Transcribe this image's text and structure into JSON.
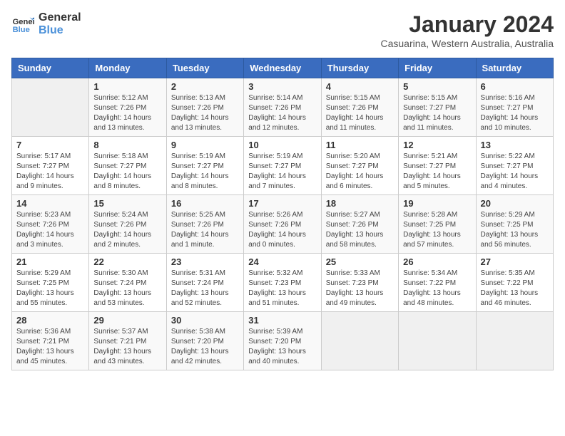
{
  "logo": {
    "name_line1": "General",
    "name_line2": "Blue"
  },
  "header": {
    "title": "January 2024",
    "subtitle": "Casuarina, Western Australia, Australia"
  },
  "days_of_week": [
    "Sunday",
    "Monday",
    "Tuesday",
    "Wednesday",
    "Thursday",
    "Friday",
    "Saturday"
  ],
  "weeks": [
    [
      {
        "day": "",
        "info": ""
      },
      {
        "day": "1",
        "info": "Sunrise: 5:12 AM\nSunset: 7:26 PM\nDaylight: 14 hours\nand 13 minutes."
      },
      {
        "day": "2",
        "info": "Sunrise: 5:13 AM\nSunset: 7:26 PM\nDaylight: 14 hours\nand 13 minutes."
      },
      {
        "day": "3",
        "info": "Sunrise: 5:14 AM\nSunset: 7:26 PM\nDaylight: 14 hours\nand 12 minutes."
      },
      {
        "day": "4",
        "info": "Sunrise: 5:15 AM\nSunset: 7:26 PM\nDaylight: 14 hours\nand 11 minutes."
      },
      {
        "day": "5",
        "info": "Sunrise: 5:15 AM\nSunset: 7:27 PM\nDaylight: 14 hours\nand 11 minutes."
      },
      {
        "day": "6",
        "info": "Sunrise: 5:16 AM\nSunset: 7:27 PM\nDaylight: 14 hours\nand 10 minutes."
      }
    ],
    [
      {
        "day": "7",
        "info": "Sunrise: 5:17 AM\nSunset: 7:27 PM\nDaylight: 14 hours\nand 9 minutes."
      },
      {
        "day": "8",
        "info": "Sunrise: 5:18 AM\nSunset: 7:27 PM\nDaylight: 14 hours\nand 8 minutes."
      },
      {
        "day": "9",
        "info": "Sunrise: 5:19 AM\nSunset: 7:27 PM\nDaylight: 14 hours\nand 8 minutes."
      },
      {
        "day": "10",
        "info": "Sunrise: 5:19 AM\nSunset: 7:27 PM\nDaylight: 14 hours\nand 7 minutes."
      },
      {
        "day": "11",
        "info": "Sunrise: 5:20 AM\nSunset: 7:27 PM\nDaylight: 14 hours\nand 6 minutes."
      },
      {
        "day": "12",
        "info": "Sunrise: 5:21 AM\nSunset: 7:27 PM\nDaylight: 14 hours\nand 5 minutes."
      },
      {
        "day": "13",
        "info": "Sunrise: 5:22 AM\nSunset: 7:27 PM\nDaylight: 14 hours\nand 4 minutes."
      }
    ],
    [
      {
        "day": "14",
        "info": "Sunrise: 5:23 AM\nSunset: 7:26 PM\nDaylight: 14 hours\nand 3 minutes."
      },
      {
        "day": "15",
        "info": "Sunrise: 5:24 AM\nSunset: 7:26 PM\nDaylight: 14 hours\nand 2 minutes."
      },
      {
        "day": "16",
        "info": "Sunrise: 5:25 AM\nSunset: 7:26 PM\nDaylight: 14 hours\nand 1 minute."
      },
      {
        "day": "17",
        "info": "Sunrise: 5:26 AM\nSunset: 7:26 PM\nDaylight: 14 hours\nand 0 minutes."
      },
      {
        "day": "18",
        "info": "Sunrise: 5:27 AM\nSunset: 7:26 PM\nDaylight: 13 hours\nand 58 minutes."
      },
      {
        "day": "19",
        "info": "Sunrise: 5:28 AM\nSunset: 7:25 PM\nDaylight: 13 hours\nand 57 minutes."
      },
      {
        "day": "20",
        "info": "Sunrise: 5:29 AM\nSunset: 7:25 PM\nDaylight: 13 hours\nand 56 minutes."
      }
    ],
    [
      {
        "day": "21",
        "info": "Sunrise: 5:29 AM\nSunset: 7:25 PM\nDaylight: 13 hours\nand 55 minutes."
      },
      {
        "day": "22",
        "info": "Sunrise: 5:30 AM\nSunset: 7:24 PM\nDaylight: 13 hours\nand 53 minutes."
      },
      {
        "day": "23",
        "info": "Sunrise: 5:31 AM\nSunset: 7:24 PM\nDaylight: 13 hours\nand 52 minutes."
      },
      {
        "day": "24",
        "info": "Sunrise: 5:32 AM\nSunset: 7:23 PM\nDaylight: 13 hours\nand 51 minutes."
      },
      {
        "day": "25",
        "info": "Sunrise: 5:33 AM\nSunset: 7:23 PM\nDaylight: 13 hours\nand 49 minutes."
      },
      {
        "day": "26",
        "info": "Sunrise: 5:34 AM\nSunset: 7:22 PM\nDaylight: 13 hours\nand 48 minutes."
      },
      {
        "day": "27",
        "info": "Sunrise: 5:35 AM\nSunset: 7:22 PM\nDaylight: 13 hours\nand 46 minutes."
      }
    ],
    [
      {
        "day": "28",
        "info": "Sunrise: 5:36 AM\nSunset: 7:21 PM\nDaylight: 13 hours\nand 45 minutes."
      },
      {
        "day": "29",
        "info": "Sunrise: 5:37 AM\nSunset: 7:21 PM\nDaylight: 13 hours\nand 43 minutes."
      },
      {
        "day": "30",
        "info": "Sunrise: 5:38 AM\nSunset: 7:20 PM\nDaylight: 13 hours\nand 42 minutes."
      },
      {
        "day": "31",
        "info": "Sunrise: 5:39 AM\nSunset: 7:20 PM\nDaylight: 13 hours\nand 40 minutes."
      },
      {
        "day": "",
        "info": ""
      },
      {
        "day": "",
        "info": ""
      },
      {
        "day": "",
        "info": ""
      }
    ]
  ]
}
